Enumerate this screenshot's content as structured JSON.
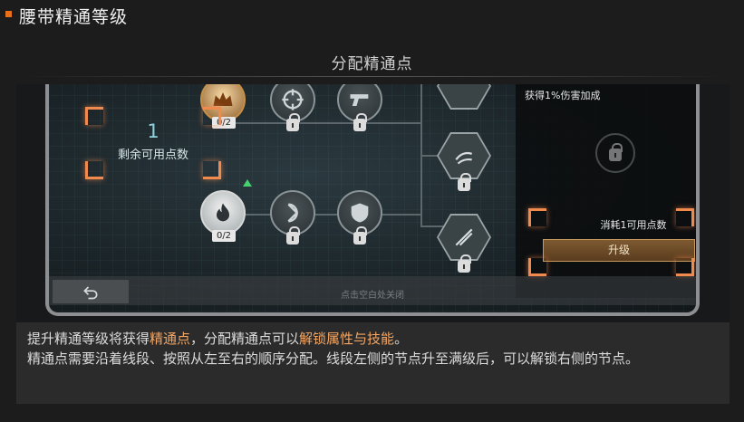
{
  "header": {
    "title": "腰带精通等级"
  },
  "subtitle": "分配精通点",
  "game": {
    "points": {
      "value": "1",
      "label": "剩余可用点数"
    },
    "nodes": [
      {
        "count": "0/2"
      },
      {
        "count": "0/2"
      }
    ],
    "side_panel": {
      "description": "获得1%伤害加成",
      "cost": "消耗1可用点数",
      "upgrade_label": "升级"
    },
    "close_hint": "点击空白处关闭"
  },
  "info": {
    "p1_a": "提升精通等级将获得",
    "p1_b": "精通点",
    "p1_c": "，分配精通点可以",
    "p1_d": "解锁属性与技能",
    "p1_e": "。",
    "p2": "精通点需要沿着线段、按照从左至右的顺序分配。线段左侧的节点升至满级后，可以解锁右侧的节点。"
  },
  "colors": {
    "accent": "#e8701a",
    "highlight": "#f3a664",
    "bracket": "#f08a4e"
  }
}
